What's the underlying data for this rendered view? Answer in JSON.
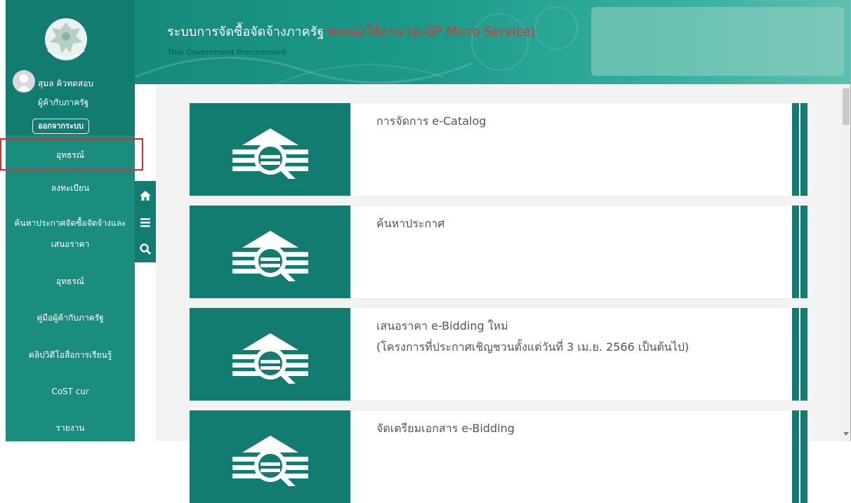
{
  "header": {
    "title": "ระบบการจัดซื้อจัดจ้างภาครัฐ",
    "title_highlight": "ทดลองใช้งาน (e-GP Micro Service)",
    "subtitle": "Thai Government Procurement",
    "logo_icon": "garuda-emblem-icon"
  },
  "user": {
    "name": "สุมล คิวทดสอบ",
    "role": "ผู้ค้ากับภาครัฐ",
    "logout_label": "ออกจากระบบ"
  },
  "sidebar": {
    "items": [
      {
        "label": "อุทธรณ์"
      },
      {
        "label": "ลงทะเบียน"
      },
      {
        "label": "ค้นหาประกาศจัดซื้อจัดจ้างและ"
      },
      {
        "label": "เสนอราคา"
      },
      {
        "label": "อุทธรณ์"
      },
      {
        "label": "คู่มือผู้ค้ากับภาครัฐ"
      },
      {
        "label": "คลิปวิดีโอสื่อการเรียนรู้"
      },
      {
        "label": "CoST cur"
      },
      {
        "label": "รายงาน"
      }
    ]
  },
  "annotation": {
    "step": "2",
    "color": "#e52b27"
  },
  "toolbar": {
    "icons": [
      "home-icon",
      "menu-icon",
      "search-icon"
    ]
  },
  "cards": [
    {
      "title": "การจัดการ e-Catalog",
      "subtitle": ""
    },
    {
      "title": "ค้นหาประกาศ",
      "subtitle": ""
    },
    {
      "title": "เสนอราคา e-Bidding ใหม่",
      "subtitle": "(โครงการที่ประกาศเชิญชวนตั้งแต่วันที่ 3 เม.ย. 2566 เป็นต้นไป)"
    },
    {
      "title": "จัดเตรียมเอกสาร e-Bidding",
      "subtitle": ""
    }
  ],
  "colors": {
    "brand_green": "#137c70",
    "sidebar_green": "#1a8d7f",
    "accent_red": "#e0322c",
    "card_text": "#555555"
  }
}
